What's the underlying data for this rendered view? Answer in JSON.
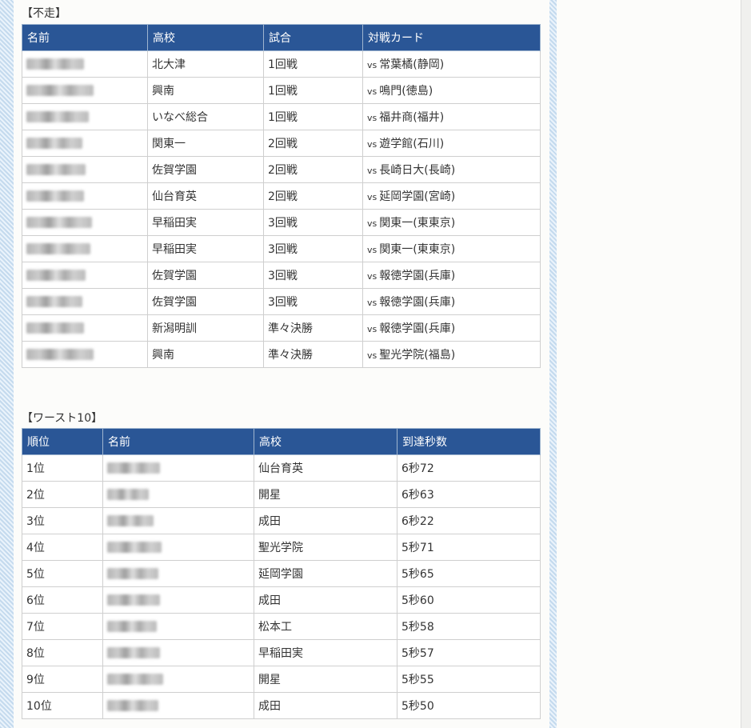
{
  "section1": {
    "label": "【不走】",
    "headers": [
      "名前",
      "高校",
      "試合",
      "対戦カード"
    ],
    "rows": [
      {
        "school": "北大津",
        "match": "1回戦",
        "opponent": "常葉橘(静岡)"
      },
      {
        "school": "興南",
        "match": "1回戦",
        "opponent": "鳴門(徳島)"
      },
      {
        "school": "いなべ総合",
        "match": "1回戦",
        "opponent": "福井商(福井)"
      },
      {
        "school": "関東一",
        "match": "2回戦",
        "opponent": "遊学館(石川)"
      },
      {
        "school": "佐賀学園",
        "match": "2回戦",
        "opponent": "長崎日大(長崎)"
      },
      {
        "school": "仙台育英",
        "match": "2回戦",
        "opponent": "延岡学園(宮崎)"
      },
      {
        "school": "早稲田実",
        "match": "3回戦",
        "opponent": "関東一(東東京)"
      },
      {
        "school": "早稲田実",
        "match": "3回戦",
        "opponent": "関東一(東東京)"
      },
      {
        "school": "佐賀学園",
        "match": "3回戦",
        "opponent": "報徳学園(兵庫)"
      },
      {
        "school": "佐賀学園",
        "match": "3回戦",
        "opponent": "報徳学園(兵庫)"
      },
      {
        "school": "新潟明訓",
        "match": "準々決勝",
        "opponent": "報徳学園(兵庫)"
      },
      {
        "school": "興南",
        "match": "準々決勝",
        "opponent": "聖光学院(福島)"
      }
    ],
    "vs_label": "vs"
  },
  "section2": {
    "label": "【ワースト10】",
    "headers": [
      "順位",
      "名前",
      "高校",
      "到達秒数"
    ],
    "rows": [
      {
        "rank": "1位",
        "school": "仙台育英",
        "time": "6秒72"
      },
      {
        "rank": "2位",
        "school": "開星",
        "time": "6秒63"
      },
      {
        "rank": "3位",
        "school": "成田",
        "time": "6秒22"
      },
      {
        "rank": "4位",
        "school": "聖光学院",
        "time": "5秒71"
      },
      {
        "rank": "5位",
        "school": "延岡学園",
        "time": "5秒65"
      },
      {
        "rank": "6位",
        "school": "成田",
        "time": "5秒60"
      },
      {
        "rank": "7位",
        "school": "松本工",
        "time": "5秒58"
      },
      {
        "rank": "8位",
        "school": "早稲田実",
        "time": "5秒57"
      },
      {
        "rank": "9位",
        "school": "開星",
        "time": "5秒55"
      },
      {
        "rank": "10位",
        "school": "成田",
        "time": "5秒50"
      }
    ]
  },
  "colors": {
    "header_bg": "#2a5696",
    "stripe": "#c4daee",
    "border": "#cfcfcf"
  }
}
